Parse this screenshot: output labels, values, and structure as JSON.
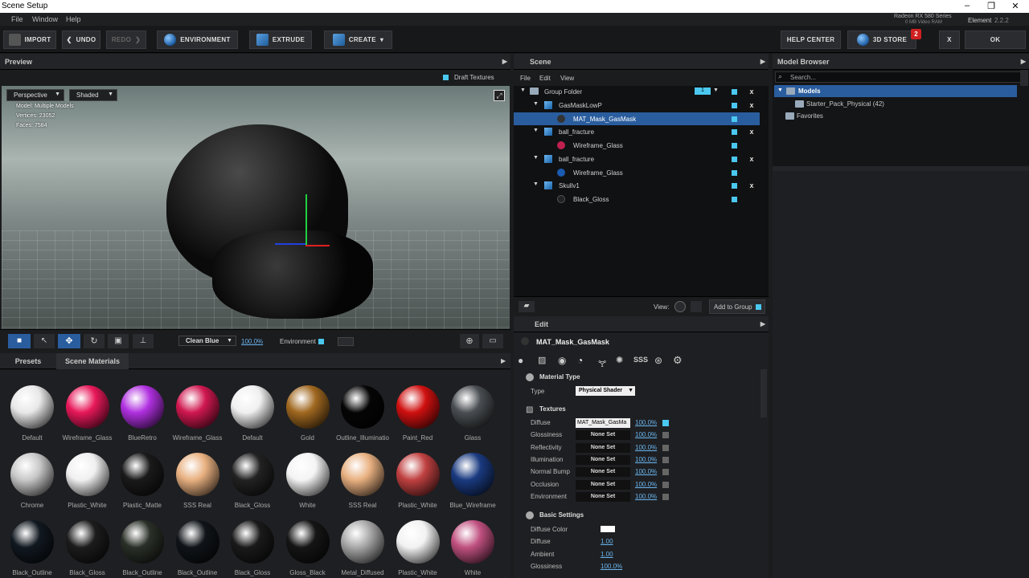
{
  "window": {
    "title": "Scene Setup"
  },
  "menu": [
    "File",
    "Window",
    "Help"
  ],
  "gpu": {
    "name": "Radeon RX 580 Series",
    "vram": "0 MB Video RAM"
  },
  "product": {
    "name": "Element",
    "version": "2.2.2"
  },
  "toolbar": {
    "import": "IMPORT",
    "undo": "UNDO",
    "redo": "REDO",
    "environment": "ENVIRONMENT",
    "extrude": "EXTRUDE",
    "create": "CREATE",
    "help_center": "HELP CENTER",
    "store": "3D STORE",
    "store_badge": "2",
    "close": "X",
    "ok": "OK"
  },
  "preview": {
    "title": "Preview",
    "draft_textures": "Draft Textures",
    "view_mode": "Perspective",
    "shade_mode": "Shaded",
    "info": {
      "model": "Model: Multiple Models",
      "vertices": "Vertices: 23052",
      "faces": "Faces: 7584"
    },
    "env_preset": "Clean Blue",
    "env_pct": "100.0%",
    "environment_label": "Environment"
  },
  "scene": {
    "title": "Scene",
    "menu": [
      "File",
      "Edit",
      "View"
    ],
    "rows": [
      {
        "label": "Group Folder",
        "count": "1"
      },
      {
        "label": "GasMaskLowP"
      },
      {
        "label": "MAT_Mask_GasMask"
      },
      {
        "label": "ball_fracture"
      },
      {
        "label": "Wireframe_Glass"
      },
      {
        "label": "ball_fracture"
      },
      {
        "label": "Wireframe_Glass"
      },
      {
        "label": "Skullv1"
      },
      {
        "label": "Black_Gloss"
      }
    ],
    "view_label": "View:",
    "add_group": "Add to Group"
  },
  "model_browser": {
    "title": "Model Browser",
    "search_placeholder": "Search...",
    "models": "Models",
    "starter": "Starter_Pack_Physical (42)",
    "favorites": "Favorites"
  },
  "edit": {
    "title": "Edit",
    "material_name": "MAT_Mask_GasMask",
    "material_type_header": "Material Type",
    "type_label": "Type",
    "type_value": "Physical Shader",
    "textures_header": "Textures",
    "textures": [
      {
        "name": "Diffuse",
        "value": "MAT_Mask_GasMa",
        "pct": "100.0%"
      },
      {
        "name": "Glossiness",
        "value": "None Set",
        "pct": "100.0%"
      },
      {
        "name": "Reflectivity",
        "value": "None Set",
        "pct": "100.0%"
      },
      {
        "name": "Illumination",
        "value": "None Set",
        "pct": "100.0%"
      },
      {
        "name": "Normal Bump",
        "value": "None Set",
        "pct": "100.0%"
      },
      {
        "name": "Occlusion",
        "value": "None Set",
        "pct": "100.0%"
      },
      {
        "name": "Environment",
        "value": "None Set",
        "pct": "100.0%"
      }
    ],
    "basic_header": "Basic Settings",
    "basic": [
      {
        "name": "Diffuse Color",
        "value": ""
      },
      {
        "name": "Diffuse",
        "value": "1.00"
      },
      {
        "name": "Ambient",
        "value": "1.00"
      },
      {
        "name": "Glossiness",
        "value": "100.0%"
      }
    ]
  },
  "presets": {
    "tab_presets": "Presets",
    "tab_scene": "Scene Materials",
    "materials": [
      {
        "name": "Default",
        "color": "#e8e8e8"
      },
      {
        "name": "Wireframe_Glass",
        "color": "#e8185a"
      },
      {
        "name": "BlueRetro",
        "color": "#b030e0"
      },
      {
        "name": "Wireframe_Glass",
        "color": "#d01850"
      },
      {
        "name": "Default",
        "color": "#f0f0f0"
      },
      {
        "name": "Gold",
        "color": "#a06820"
      },
      {
        "name": "Outline_Illuminatio",
        "color": "#050505"
      },
      {
        "name": "Paint_Red",
        "color": "#d01010"
      },
      {
        "name": "Glass",
        "color": "#4a4e52"
      },
      {
        "name": "Chrome",
        "color": "#c8c8c8"
      },
      {
        "name": "Plastic_White",
        "color": "#f0f0f0"
      },
      {
        "name": "Plastic_Matte",
        "color": "#1a1a1a"
      },
      {
        "name": "SSS Real",
        "color": "#e8b080"
      },
      {
        "name": "Black_Gloss",
        "color": "#222222"
      },
      {
        "name": "White",
        "color": "#f4f4f4"
      },
      {
        "name": "SSS Real",
        "color": "#e8b080"
      },
      {
        "name": "Plastic_White",
        "color": "#c04040"
      },
      {
        "name": "Blue_Wireframe",
        "color": "#1a3a80"
      },
      {
        "name": "Black_Outline",
        "color": "#111820"
      },
      {
        "name": "Black_Gloss",
        "color": "#1c1c1c"
      },
      {
        "name": "Black_Outline",
        "color": "#2a3028"
      },
      {
        "name": "Black_Outline",
        "color": "#101418"
      },
      {
        "name": "Black_Gloss",
        "color": "#1a1a1a"
      },
      {
        "name": "Gloss_Black",
        "color": "#151515"
      },
      {
        "name": "Metal_Diffused",
        "color": "#a8a8a8"
      },
      {
        "name": "Plastic_White",
        "color": "#f2f2f2"
      },
      {
        "name": "White",
        "color": "#c05080"
      }
    ]
  }
}
